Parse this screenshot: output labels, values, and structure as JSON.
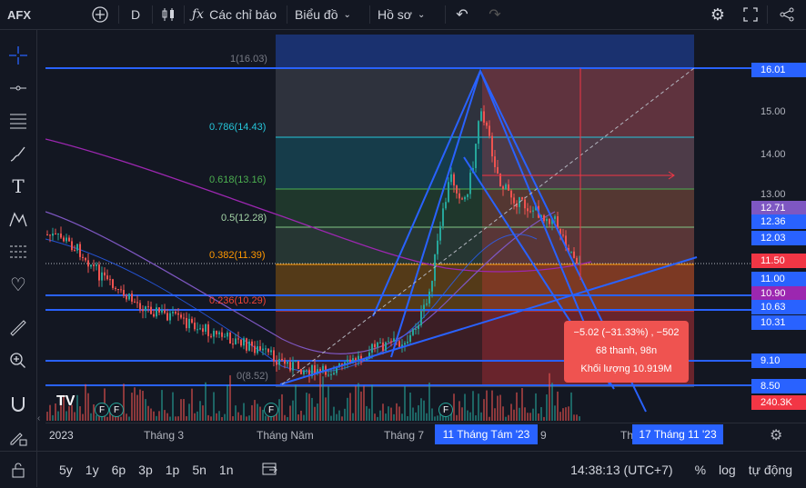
{
  "toolbar": {
    "symbol": "AFX",
    "interval": "D",
    "indicators_label": "Các chỉ báo",
    "chart_label": "Biểu đồ",
    "profile_label": "Hồ sơ"
  },
  "fib_levels": [
    {
      "label": "1(16.03)",
      "color": "#787b86"
    },
    {
      "label": "0.786(14.43)",
      "color": "#26c6da"
    },
    {
      "label": "0.618(13.16)",
      "color": "#4caf50"
    },
    {
      "label": "0.5(12.28)",
      "color": "#a5d6a7"
    },
    {
      "label": "0.382(11.39)",
      "color": "#ff9800"
    },
    {
      "label": "0.236(10.29)",
      "color": "#f44336"
    },
    {
      "label": "0(8.52)",
      "color": "#787b86"
    }
  ],
  "price_axis": {
    "ticks": [
      "15.00",
      "14.00",
      "13.00"
    ],
    "labels": [
      {
        "text": "16.01",
        "bg": "#2962ff",
        "fg": "#ffffff"
      },
      {
        "text": "12.71",
        "bg": "#7e57c2",
        "fg": "#ffffff"
      },
      {
        "text": "12.36",
        "bg": "#2962ff",
        "fg": "#ffffff"
      },
      {
        "text": "12.03",
        "bg": "#2962ff",
        "fg": "#ffffff"
      },
      {
        "text": "11.50",
        "bg": "#f23645",
        "fg": "#ffffff"
      },
      {
        "text": "11.00",
        "bg": "#2962ff",
        "fg": "#ffffff"
      },
      {
        "text": "10.90",
        "bg": "#9c27b0",
        "fg": "#ffffff"
      },
      {
        "text": "10.63",
        "bg": "#2962ff",
        "fg": "#ffffff"
      },
      {
        "text": "10.31",
        "bg": "#2962ff",
        "fg": "#ffffff"
      },
      {
        "text": "9.10",
        "bg": "#2962ff",
        "fg": "#ffffff"
      },
      {
        "text": "8.50",
        "bg": "#2962ff",
        "fg": "#ffffff"
      },
      {
        "text": "240.3K",
        "bg": "#f23645",
        "fg": "#ffffff"
      }
    ]
  },
  "tooltip": {
    "line1": "−5.02 (−31.33%) , −502",
    "line2": "68 thanh, 98n",
    "line3": "Khối lượng 10.919M"
  },
  "time_axis": {
    "labels": [
      "2023",
      "Tháng 3",
      "Tháng Năm",
      "Tháng 7",
      "9",
      "Th"
    ],
    "highlight1": "11 Tháng Tám '23",
    "highlight2": "17 Tháng 11 '23"
  },
  "bottom": {
    "ranges": [
      "5y",
      "1y",
      "6p",
      "3p",
      "1p",
      "5n",
      "1n"
    ],
    "clock": "14:38:13 (UTC+7)",
    "percent": "%",
    "log": "log",
    "auto": "tự động"
  },
  "markers": {
    "earnings": "F"
  },
  "colors": {
    "up": "#26a69a",
    "down": "#ef5350",
    "accent": "#2962ff"
  }
}
